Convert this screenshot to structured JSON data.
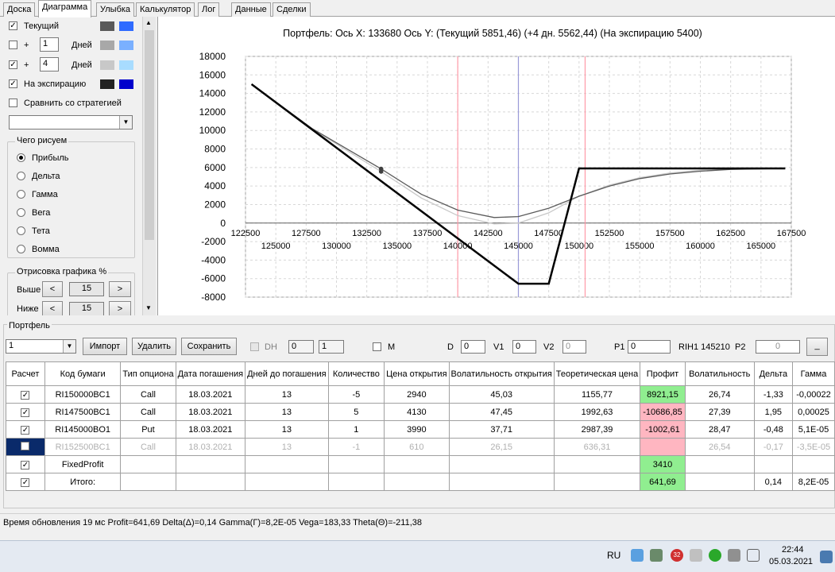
{
  "tabs": [
    "Доска",
    "Диаграмма",
    "Улыбка",
    "Калькулятор",
    "Лог",
    "Данные",
    "Сделки"
  ],
  "left": {
    "row_current": {
      "label": "Текущий",
      "checked": true,
      "c1": "#5a5a5a",
      "c2": "#2f6bff"
    },
    "row_plus1": {
      "plus": "+",
      "value": "1",
      "days": "Дней",
      "checked": false,
      "c1": "#a8a8a8",
      "c2": "#7ab0ff"
    },
    "row_plus4": {
      "plus": "+",
      "value": "4",
      "days": "Дней",
      "checked": true,
      "c1": "#c8c8c8",
      "c2": "#a8dcff"
    },
    "row_expiry": {
      "label": "На экспирацию",
      "checked": true,
      "c1": "#222222",
      "c2": "#0000cc"
    },
    "compare": {
      "label": "Сравнить со стратегией",
      "checked": false
    },
    "draw_group": {
      "title": "Чего рисуем",
      "options": [
        "Прибыль",
        "Дельта",
        "Гамма",
        "Вега",
        "Тета",
        "Вомма"
      ],
      "selected": 0
    },
    "render_group": {
      "title": "Отрисовка графика %",
      "above_label": "Выше",
      "above": "15",
      "below_label": "Ниже",
      "below": "15",
      "lt": "<",
      "gt": ">"
    }
  },
  "chart_data": {
    "type": "line",
    "title": "Портфель: Ось X: 133680 Ось Y:  (Текущий 5851,46)  (+4 дн. 5562,44)  (На экспирацию 5400)",
    "xlim": [
      122500,
      167500
    ],
    "ylim": [
      -8000,
      18000
    ],
    "yticks": [
      "18000",
      "16000",
      "14000",
      "12000",
      "10000",
      "8000",
      "6000",
      "4000",
      "2000",
      "0",
      "-2000",
      "-4000",
      "-6000",
      "-8000"
    ],
    "xticks_top": [
      "122500",
      "127500",
      "132500",
      "137500",
      "142500",
      "147500",
      "152500",
      "157500",
      "162500",
      "167500"
    ],
    "xticks_bottom": [
      "125000",
      "130000",
      "135000",
      "140000",
      "145000",
      "150000",
      "155000",
      "160000",
      "165000"
    ],
    "vlines": [
      {
        "x": 140000,
        "color": "#ff9aa8"
      },
      {
        "x": 145000,
        "color": "#9a9ad8"
      },
      {
        "x": 150500,
        "color": "#ff9aa8"
      }
    ],
    "series": [
      {
        "color": "#000000",
        "points": [
          [
            123000,
            15000
          ],
          [
            145000,
            -6550
          ],
          [
            147500,
            -6550
          ],
          [
            150000,
            5900
          ],
          [
            167000,
            5900
          ]
        ]
      },
      {
        "color": "#5a5a5a",
        "points": [
          [
            123000,
            15000
          ],
          [
            128000,
            10200
          ],
          [
            133680,
            5851
          ],
          [
            137000,
            3100
          ],
          [
            140000,
            1400
          ],
          [
            143000,
            600
          ],
          [
            145000,
            700
          ],
          [
            147500,
            1600
          ],
          [
            150000,
            2900
          ],
          [
            152500,
            4000
          ],
          [
            155000,
            4800
          ],
          [
            157500,
            5300
          ],
          [
            160000,
            5600
          ],
          [
            162500,
            5800
          ],
          [
            167000,
            5900
          ]
        ]
      },
      {
        "color": "#c8c8c8",
        "points": [
          [
            123000,
            15000
          ],
          [
            128000,
            10150
          ],
          [
            133680,
            5562
          ],
          [
            137000,
            2700
          ],
          [
            140000,
            800
          ],
          [
            143000,
            -100
          ],
          [
            145000,
            0
          ],
          [
            147500,
            1100
          ],
          [
            150000,
            2900
          ],
          [
            152500,
            4100
          ],
          [
            155000,
            4900
          ],
          [
            157500,
            5400
          ],
          [
            160000,
            5700
          ],
          [
            162500,
            5850
          ],
          [
            167000,
            5900
          ]
        ]
      }
    ],
    "markers": [
      {
        "x": 133680,
        "y": 5851
      },
      {
        "x": 133680,
        "y": 5562
      }
    ]
  },
  "portfolio": {
    "title": "Портфель",
    "select_value": "1",
    "btn_import": "Импорт",
    "btn_delete": "Удалить",
    "btn_save": "Сохранить",
    "dh": "DH",
    "dh1": "0",
    "dh2": "1",
    "m": "M",
    "d_label": "D",
    "d_val": "0",
    "v1_label": "V1",
    "v1_val": "0",
    "v2_label": "V2",
    "v2_val": "0",
    "p1_label": "P1",
    "p1_val": "0",
    "rih": "RIH1 145210",
    "p2_label": "P2",
    "p2_val": "0",
    "min_btn": "_",
    "headers": [
      "Расчет",
      "Код бумаги",
      "Тип опциона",
      "Дата погашения",
      "Дней до погашения",
      "Количество",
      "Цена открытия",
      "Волатильность открытия",
      "Теоретическая цена",
      "Профит",
      "Волатильность",
      "Дельта",
      "Гамма"
    ],
    "rows": [
      {
        "checked": true,
        "cells": [
          "RI150000BC1",
          "Call",
          "18.03.2021",
          "13",
          "-5",
          "2940",
          "45,03",
          "1155,77",
          "8921,15",
          "26,74",
          "-1,33",
          "-0,00022"
        ],
        "profit": "green"
      },
      {
        "checked": true,
        "cells": [
          "RI147500BC1",
          "Call",
          "18.03.2021",
          "13",
          "5",
          "4130",
          "47,45",
          "1992,63",
          "-10686,85",
          "27,39",
          "1,95",
          "0,00025"
        ],
        "profit": "pink"
      },
      {
        "checked": true,
        "cells": [
          "RI145000BO1",
          "Put",
          "18.03.2021",
          "13",
          "1",
          "3990",
          "37,71",
          "2987,39",
          "-1002,61",
          "28,47",
          "-0,48",
          "5,1E-05"
        ],
        "profit": "pink"
      },
      {
        "checked": false,
        "dim": true,
        "cells": [
          "RI152500BC1",
          "Call",
          "18.03.2021",
          "13",
          "-1",
          "610",
          "26,15",
          "636,31",
          "",
          "26,54",
          "-0,17",
          "-3,5E-05"
        ],
        "profit": "pink"
      },
      {
        "checked": true,
        "cells": [
          "FixedProfit",
          "",
          "",
          "",
          "",
          "",
          "",
          "",
          "3410",
          "",
          "",
          ""
        ],
        "profit": "green"
      },
      {
        "checked": true,
        "cells": [
          "Итого:",
          "",
          "",
          "",
          "",
          "",
          "",
          "",
          "641,69",
          "",
          "0,14",
          "8,2E-05"
        ],
        "profit": "green"
      }
    ]
  },
  "status": "Время обновления 19 мс  Profit=641,69 Delta(Δ)=0,14 Gamma(Γ)=8,2E-05 Vega=183,33 Theta(Θ)=-211,38",
  "taskbar": {
    "lang": "RU",
    "time": "22:44",
    "date": "05.03.2021",
    "badge": "32"
  }
}
